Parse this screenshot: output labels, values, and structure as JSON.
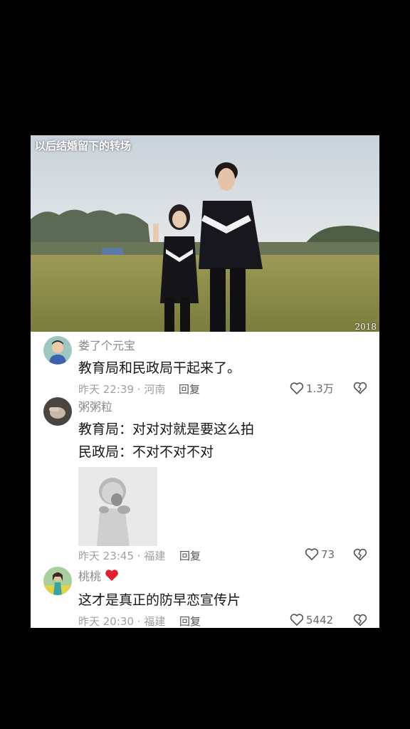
{
  "photo": {
    "caption": "以后结婚留下的转场",
    "year": "2018"
  },
  "comments": [
    {
      "username": "娄了个元宝",
      "lines": [
        "教育局和民政局干起来了。"
      ],
      "time": "昨天 22:39",
      "location": "河南",
      "reply": "回复",
      "likes": "1.3万",
      "avatar_icon": "boy-avatar"
    },
    {
      "username": "粥粥粒",
      "lines": [
        "教育局：对对对就是要这么拍",
        "民政局：不对不对不对"
      ],
      "sticker": "baby-covering-mouth-sticker",
      "time": "昨天 23:45",
      "location": "福建",
      "reply": "回复",
      "likes": "73",
      "avatar_icon": "hand-avatar"
    },
    {
      "username": "桃桃",
      "username_emoji": "❤️",
      "lines": [
        "这才是真正的防早恋宣传片"
      ],
      "time": "昨天 20:30",
      "location": "福建",
      "reply": "回复",
      "likes": "5442",
      "avatar_icon": "girl-flowers-avatar"
    }
  ],
  "colors": {
    "heart": "#e0202e",
    "meta": "#a0a0a0",
    "username": "#8a8a8a",
    "text": "#161616"
  }
}
